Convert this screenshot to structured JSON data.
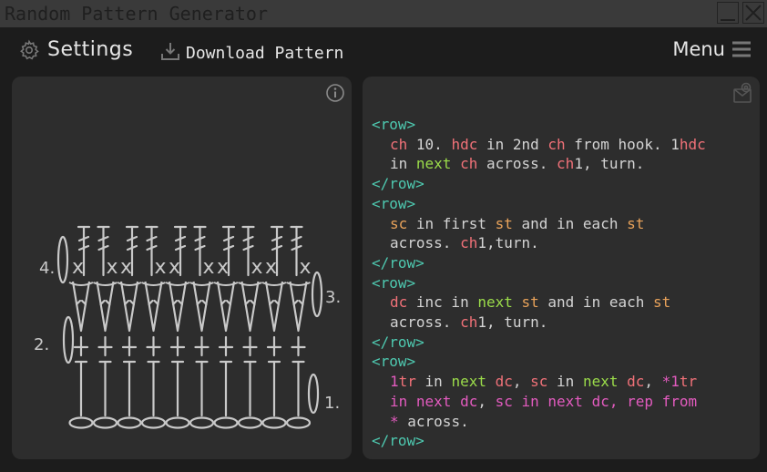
{
  "window": {
    "title": "Random Pattern Generator",
    "minimize_icon": "minimize-icon",
    "close_icon": "close-icon"
  },
  "toolbar": {
    "settings_label": "Settings",
    "settings_icon": "gear-icon",
    "download_label": "Download Pattern",
    "download_icon": "download-icon",
    "menu_label": "Menu",
    "menu_icon": "hamburger-icon"
  },
  "diagram_panel": {
    "info_icon": "info-icon",
    "row_labels": [
      "1.",
      "2.",
      "3.",
      "4."
    ],
    "stitch_count": 10
  },
  "pattern_panel": {
    "copy_icon": "copy-icon",
    "open_tag": "<row>",
    "close_tag": "</row>",
    "rows": [
      {
        "lines": [
          [
            {
              "t": "ch",
              "c": "red"
            },
            {
              "t": " 10. ",
              "c": "w"
            },
            {
              "t": "hdc",
              "c": "red"
            },
            {
              "t": " in 2nd ",
              "c": "w"
            },
            {
              "t": "ch",
              "c": "red"
            },
            {
              "t": " from hook. 1",
              "c": "w"
            },
            {
              "t": "hdc",
              "c": "red"
            }
          ],
          [
            {
              "t": "in ",
              "c": "w"
            },
            {
              "t": "next",
              "c": "green"
            },
            {
              "t": " ",
              "c": "w"
            },
            {
              "t": "ch",
              "c": "red"
            },
            {
              "t": " across. ",
              "c": "w"
            },
            {
              "t": "ch",
              "c": "red"
            },
            {
              "t": "1, turn.",
              "c": "w"
            }
          ]
        ]
      },
      {
        "lines": [
          [
            {
              "t": "sc",
              "c": "orange"
            },
            {
              "t": " in first ",
              "c": "w"
            },
            {
              "t": "st",
              "c": "orange"
            },
            {
              "t": " and in each ",
              "c": "w"
            },
            {
              "t": "st",
              "c": "orange"
            }
          ],
          [
            {
              "t": "across. ",
              "c": "w"
            },
            {
              "t": "ch",
              "c": "red"
            },
            {
              "t": "1,turn.",
              "c": "w"
            }
          ]
        ]
      },
      {
        "lines": [
          [
            {
              "t": "dc",
              "c": "red"
            },
            {
              "t": " inc in ",
              "c": "w"
            },
            {
              "t": "next",
              "c": "green"
            },
            {
              "t": " ",
              "c": "w"
            },
            {
              "t": "st",
              "c": "orange"
            },
            {
              "t": " and in each ",
              "c": "w"
            },
            {
              "t": "st",
              "c": "orange"
            }
          ],
          [
            {
              "t": "across. ",
              "c": "w"
            },
            {
              "t": "ch",
              "c": "red"
            },
            {
              "t": "1, turn.",
              "c": "w"
            }
          ]
        ]
      },
      {
        "lines": [
          [
            {
              "t": "1",
              "c": "pink"
            },
            {
              "t": "tr",
              "c": "red"
            },
            {
              "t": " in ",
              "c": "w"
            },
            {
              "t": "next",
              "c": "green"
            },
            {
              "t": " ",
              "c": "w"
            },
            {
              "t": "dc",
              "c": "red"
            },
            {
              "t": ", ",
              "c": "w"
            },
            {
              "t": "sc",
              "c": "red"
            },
            {
              "t": " in ",
              "c": "w"
            },
            {
              "t": "next",
              "c": "green"
            },
            {
              "t": " ",
              "c": "w"
            },
            {
              "t": "dc",
              "c": "red"
            },
            {
              "t": ", ",
              "c": "w"
            },
            {
              "t": "*1",
              "c": "pink"
            },
            {
              "t": "tr",
              "c": "red"
            }
          ],
          [
            {
              "t": "in next ",
              "c": "pink"
            },
            {
              "t": "dc",
              "c": "pink"
            },
            {
              "t": ", ",
              "c": "w"
            },
            {
              "t": "sc",
              "c": "pink"
            },
            {
              "t": " in next ",
              "c": "pink"
            },
            {
              "t": "dc",
              "c": "pink"
            },
            {
              "t": ", rep from",
              "c": "pink"
            }
          ],
          [
            {
              "t": "*",
              "c": "pink"
            },
            {
              "t": " across.",
              "c": "w"
            }
          ]
        ]
      }
    ]
  },
  "colors": {
    "tag": "#4ec9b0",
    "red": "#f07178",
    "green": "#9bdc4a",
    "orange": "#e8a25a",
    "pink": "#e35bbf",
    "w": "#d4d4d4",
    "background": "#1c1c1c",
    "panel": "#2d2d2d"
  }
}
